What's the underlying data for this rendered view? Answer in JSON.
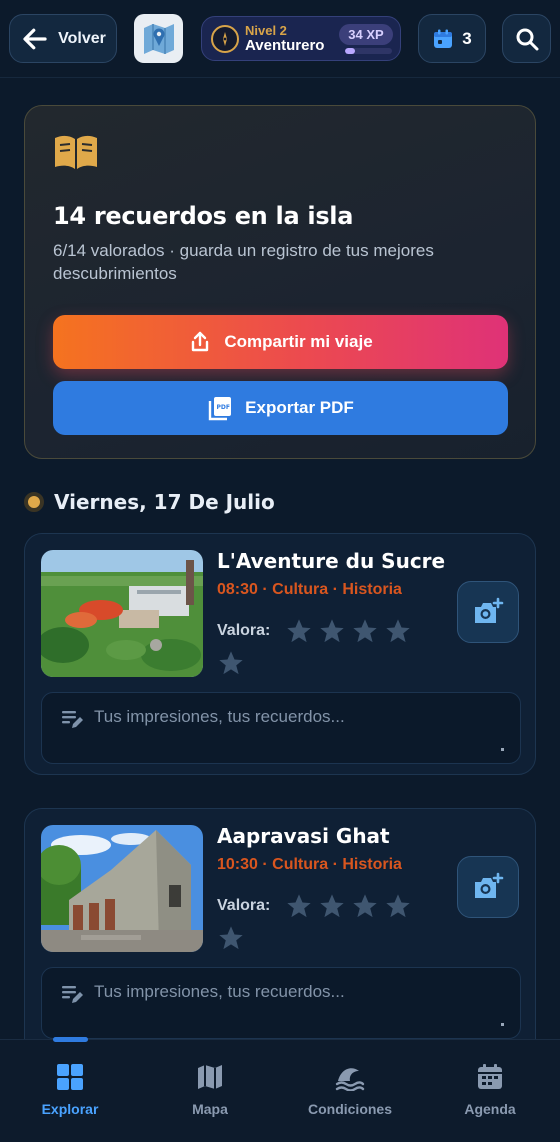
{
  "header": {
    "back_label": "Volver",
    "level_small": "Nivel 2",
    "level_name": "Aventurero",
    "xp_label": "34 XP",
    "xp_progress": 0.22,
    "calendar_count": "3"
  },
  "summary": {
    "title": "14 recuerdos en la isla",
    "subtitle": "6/14 valorados · guarda un registro de tus mejores descubrimientos",
    "share_label": "Compartir mi viaje",
    "pdf_label": "Exportar PDF"
  },
  "day": {
    "title": "Viernes, 17 De Julio"
  },
  "cards": [
    {
      "name": "L'Aventure du Sucre",
      "meta": "08:30 · Cultura · Historia",
      "rate_label": "Valora:",
      "notes_placeholder": "Tus impresiones, tus recuerdos..."
    },
    {
      "name": "Aapravasi Ghat",
      "meta": "10:30 · Cultura · Historia",
      "rate_label": "Valora:",
      "notes_placeholder": "Tus impresiones, tus recuerdos..."
    }
  ],
  "tabs": [
    {
      "label": "Explorar",
      "icon": "grid-icon"
    },
    {
      "label": "Mapa",
      "icon": "map-icon"
    },
    {
      "label": "Condiciones",
      "icon": "waves-icon"
    },
    {
      "label": "Agenda",
      "icon": "calendar-icon"
    }
  ],
  "colors": {
    "accent_blue": "#2f7be0",
    "accent_orange": "#d9561f",
    "gold": "#e0a94a"
  }
}
